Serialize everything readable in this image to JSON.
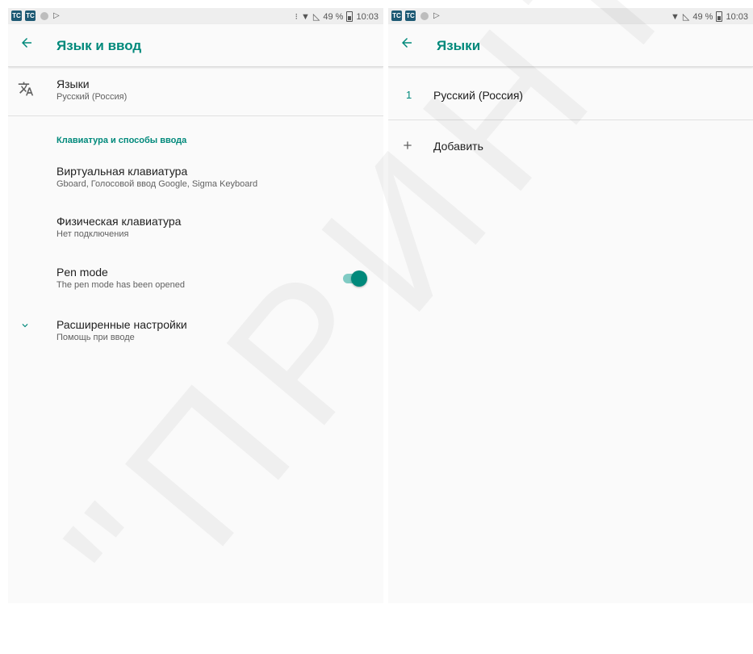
{
  "status_bar_left": {
    "tc_badge": "TC",
    "icons": [
      "tc-app-icon",
      "tc-app-icon",
      "record-dot-icon",
      "play-store-icon"
    ]
  },
  "left": {
    "status": {
      "vibrate_icon": "⁝",
      "battery_pct": "49 %",
      "time": "10:03"
    },
    "appbar": {
      "title": "Язык и ввод"
    },
    "languages": {
      "title": "Языки",
      "subtitle": "Русский (Россия)"
    },
    "section_header": "Клавиатура и способы ввода",
    "virtual_keyboard": {
      "title": "Виртуальная клавиатура",
      "subtitle": "Gboard, Голосовой ввод Google, Sigma Keyboard"
    },
    "physical_keyboard": {
      "title": "Физическая клавиатура",
      "subtitle": "Нет подключения"
    },
    "pen_mode": {
      "title": "Pen mode",
      "subtitle": "The pen mode has been opened",
      "enabled": true
    },
    "advanced": {
      "title": "Расширенные настройки",
      "subtitle": "Помощь при вводе"
    }
  },
  "right": {
    "status": {
      "battery_pct": "49 %",
      "time": "10:03"
    },
    "appbar": {
      "title": "Языки"
    },
    "language_item": {
      "index": "1",
      "label": "Русский (Россия)"
    },
    "add_item": {
      "label": "Добавить"
    }
  },
  "watermark": "\"ПРИНТ\"",
  "colors": {
    "accent": "#00897b",
    "accent_light": "#80cbc4",
    "background": "#fafafa"
  }
}
